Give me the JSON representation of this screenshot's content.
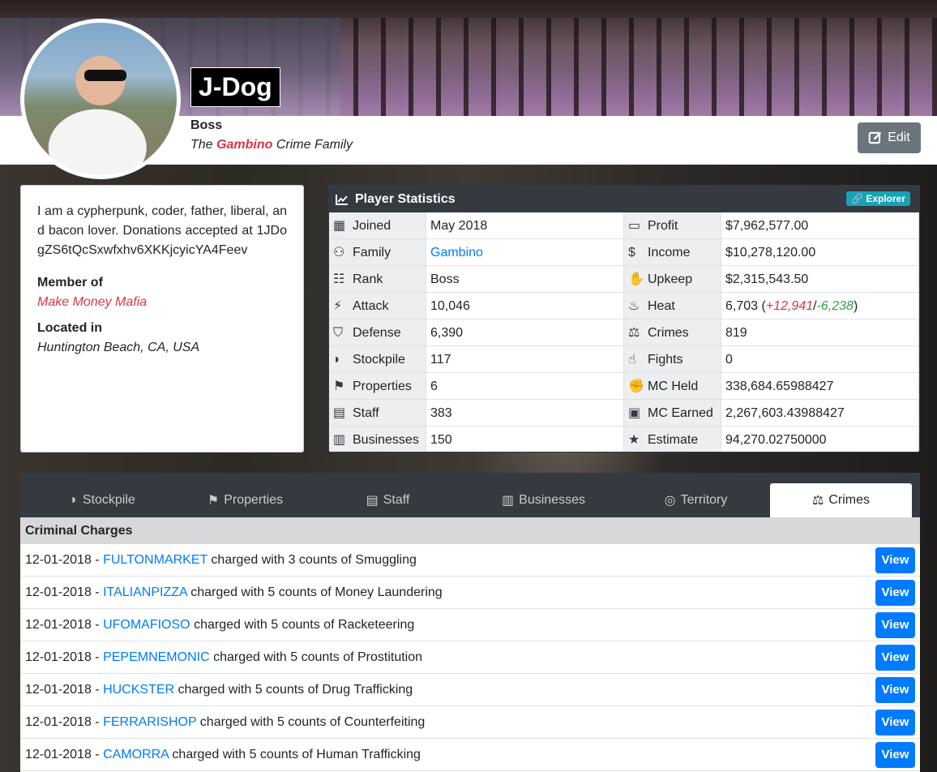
{
  "profile": {
    "name": "J-Dog",
    "rank": "Boss",
    "family_prefix": "The",
    "family_name": "Gambino",
    "family_suffix": "Crime Family",
    "edit_label": "Edit"
  },
  "bio": {
    "text": "I am a cypherpunk, coder, father, liberal, and bacon lover. Donations accepted at 1JDogZS6tQcSxwfxhv6XKKjcyicYA4Feev",
    "member_of_label": "Member of",
    "member_of": "Make Money Mafia",
    "located_label": "Located in",
    "location": "Huntington Beach, CA, USA"
  },
  "stats": {
    "title": "Player Statistics",
    "explorer_label": "Explorer",
    "rows": [
      {
        "l_label": "Joined",
        "l_icon": "calendar-icon",
        "l_value": "May 2018",
        "r_label": "Profit",
        "r_icon": "money-bill-icon",
        "r_value": "$7,962,577.00"
      },
      {
        "l_label": "Family",
        "l_icon": "users-icon",
        "l_value": "Gambino",
        "r_label": "Income",
        "r_icon": "dollar-icon",
        "r_value": "$10,278,120.00"
      },
      {
        "l_label": "Rank",
        "l_icon": "sitemap-icon",
        "l_value": "Boss",
        "r_label": "Upkeep",
        "r_icon": "hand-holding-icon",
        "r_value": "$2,315,543.50"
      },
      {
        "l_label": "Attack",
        "l_icon": "bolt-icon",
        "l_value": "10,046",
        "r_label": "Heat",
        "r_icon": "fire-icon",
        "r_value": "6,703"
      },
      {
        "l_label": "Defense",
        "l_icon": "shield-icon",
        "l_value": "6,390",
        "r_label": "Crimes",
        "r_icon": "balance-scale-icon",
        "r_value": "819"
      },
      {
        "l_label": "Stockpile",
        "l_icon": "piggy-bank-icon",
        "l_value": "117",
        "r_label": "Fights",
        "r_icon": "thumbs-up-icon",
        "r_value": "0"
      },
      {
        "l_label": "Properties",
        "l_icon": "flag-icon",
        "l_value": "6",
        "r_label": "MC Held",
        "r_icon": "fist-icon",
        "r_value": "338,684.65988427"
      },
      {
        "l_label": "Staff",
        "l_icon": "id-card-icon",
        "l_value": "383",
        "r_label": "MC Earned",
        "r_icon": "briefcase-icon",
        "r_value": "2,267,603.43988427"
      },
      {
        "l_label": "Businesses",
        "l_icon": "building-icon",
        "l_value": "150",
        "r_label": "Estimate",
        "r_icon": "trophy-icon",
        "r_value": "94,270.02750000"
      }
    ],
    "heat_plus": "+12,941",
    "heat_minus": "-6,238"
  },
  "tabs": [
    {
      "label": "Stockpile",
      "icon": "piggy-bank-icon"
    },
    {
      "label": "Properties",
      "icon": "flag-icon"
    },
    {
      "label": "Staff",
      "icon": "id-card-icon"
    },
    {
      "label": "Businesses",
      "icon": "building-icon"
    },
    {
      "label": "Territory",
      "icon": "globe-icon"
    },
    {
      "label": "Crimes",
      "icon": "balance-scale-icon"
    }
  ],
  "charges": {
    "title": "Criminal Charges",
    "view_label": "View",
    "rows": [
      {
        "date": "12-01-2018",
        "user": "FULTONMARKET",
        "text": "charged with 3 counts of Smuggling"
      },
      {
        "date": "12-01-2018",
        "user": "ITALIANPIZZA",
        "text": "charged with 5 counts of Money Laundering"
      },
      {
        "date": "12-01-2018",
        "user": "UFOMAFIOSO",
        "text": "charged with 5 counts of Racketeering"
      },
      {
        "date": "12-01-2018",
        "user": "PEPEMNEMONIC",
        "text": "charged with 5 counts of Prostitution"
      },
      {
        "date": "12-01-2018",
        "user": "HUCKSTER",
        "text": "charged with 5 counts of Drug Trafficking"
      },
      {
        "date": "12-01-2018",
        "user": "FERRARISHOP",
        "text": "charged with 5 counts of Counterfeiting"
      },
      {
        "date": "12-01-2018",
        "user": "CAMORRA",
        "text": "charged with 5 counts of Human Trafficking"
      }
    ]
  }
}
